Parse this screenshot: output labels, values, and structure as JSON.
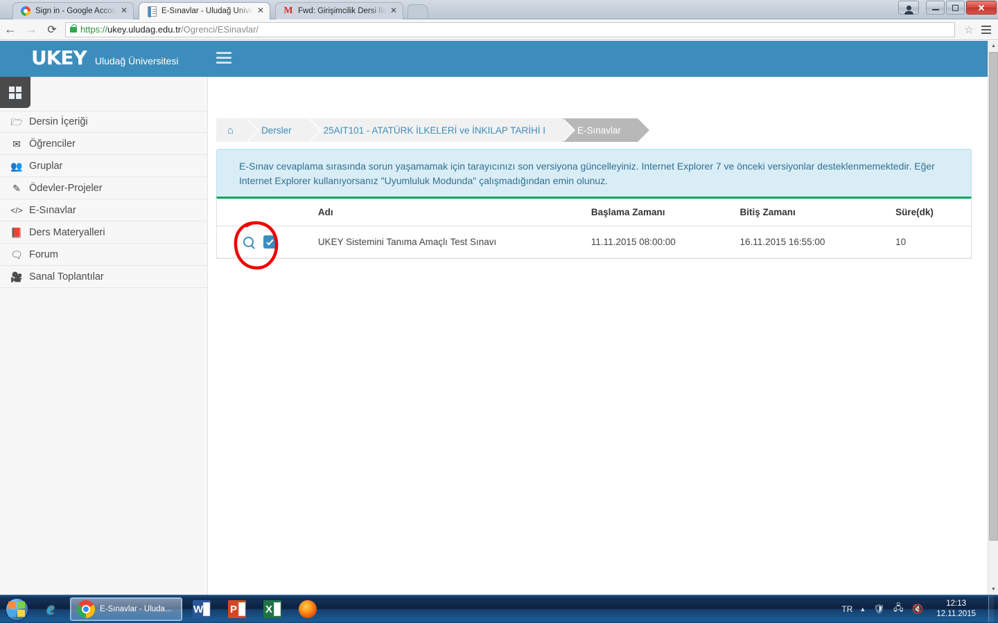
{
  "browser": {
    "tabs": [
      {
        "title": "Sign in - Google Accounts",
        "favicon": "google-icon",
        "active": false
      },
      {
        "title": "E-Sınavlar - Uludağ Üniver",
        "favicon": "document-icon",
        "active": true
      },
      {
        "title": "Fwd: Girişimcilik Dersi İlan",
        "favicon": "gmail-icon",
        "active": false
      }
    ],
    "close_label": "✕",
    "nav": {
      "back": "←",
      "forward": "→",
      "reload": "⟳"
    },
    "url": {
      "scheme": "https://",
      "host": "ukey.uludag.edu.tr",
      "path": "/Ogrenci/ESinavlar/"
    },
    "bookmark_label": "☆",
    "window_controls": {
      "person": "user-icon",
      "minimize": "–",
      "restore": "❐",
      "close": "✕"
    }
  },
  "app": {
    "logo": "UKEY",
    "logo_subtitle": "Uludağ Üniversitesi",
    "header_color": "#3c8dbc"
  },
  "sidebar": {
    "items": [
      {
        "label": "Dersin İçeriği",
        "icon": "folder-open-icon"
      },
      {
        "label": "Öğrenciler",
        "icon": "envelope-icon"
      },
      {
        "label": "Gruplar",
        "icon": "users-icon"
      },
      {
        "label": "Ödevler-Projeler",
        "icon": "edit-icon"
      },
      {
        "label": "E-Sınavlar",
        "icon": "code-icon"
      },
      {
        "label": "Ders Materyalleri",
        "icon": "book-icon"
      },
      {
        "label": "Forum",
        "icon": "comment-icon"
      },
      {
        "label": "Sanal Toplantılar",
        "icon": "video-camera-icon"
      }
    ]
  },
  "breadcrumb": {
    "home_icon": "home-icon",
    "items": [
      {
        "label": "Dersler",
        "current": false
      },
      {
        "label": "25AIT101 - ATATÜRK İLKELERİ ve İNKILAP TARİHİ I",
        "current": false
      },
      {
        "label": "E-Sınavlar",
        "current": true
      }
    ]
  },
  "alert": {
    "text": "E-Sınav cevaplama sırasında sorun yaşamamak için tarayıcınızı son versiyona güncelleyiniz. Internet Explorer 7 ve önceki versiyonlar desteklenmemektedir. Eğer Internet Explorer kullanıyorsanız \"Uyumluluk Modunda\" çalışmadığından emin olunuz.",
    "background": "#d9edf7",
    "text_color": "#31708f"
  },
  "table": {
    "accent_color": "#00a65a",
    "headers": [
      "",
      "Adı",
      "Başlama Zamanı",
      "Bitiş Zamanı",
      "Süre(dk)"
    ],
    "rows": [
      {
        "zoom_icon": "magnifier-icon",
        "checkbox_checked": true,
        "name": "UKEY Sistemini Tanıma Amaçlı Test Sınavı",
        "start": "11.11.2015 08:00:00",
        "end": "16.11.2015 16:55:00",
        "duration": "10"
      }
    ]
  },
  "annotation": {
    "shape": "red-circle-highlight",
    "color": "#ee0000"
  },
  "taskbar": {
    "start_icon": "windows-start-orb",
    "items": [
      {
        "label": "",
        "icon": "internet-explorer-icon",
        "active": false
      },
      {
        "label": "E-Sınavlar - Uluda...",
        "icon": "chrome-icon",
        "active": true
      },
      {
        "label": "",
        "icon": "word-icon",
        "active": false
      },
      {
        "label": "",
        "icon": "powerpoint-icon",
        "active": false
      },
      {
        "label": "",
        "icon": "excel-icon",
        "active": false
      },
      {
        "label": "",
        "icon": "firefox-icon",
        "active": false
      }
    ],
    "tray": {
      "language": "TR",
      "expand_icon": "▲",
      "icons": [
        "network-icon",
        "volume-muted-icon"
      ],
      "time": "12:13",
      "date": "12.11.2015"
    }
  }
}
